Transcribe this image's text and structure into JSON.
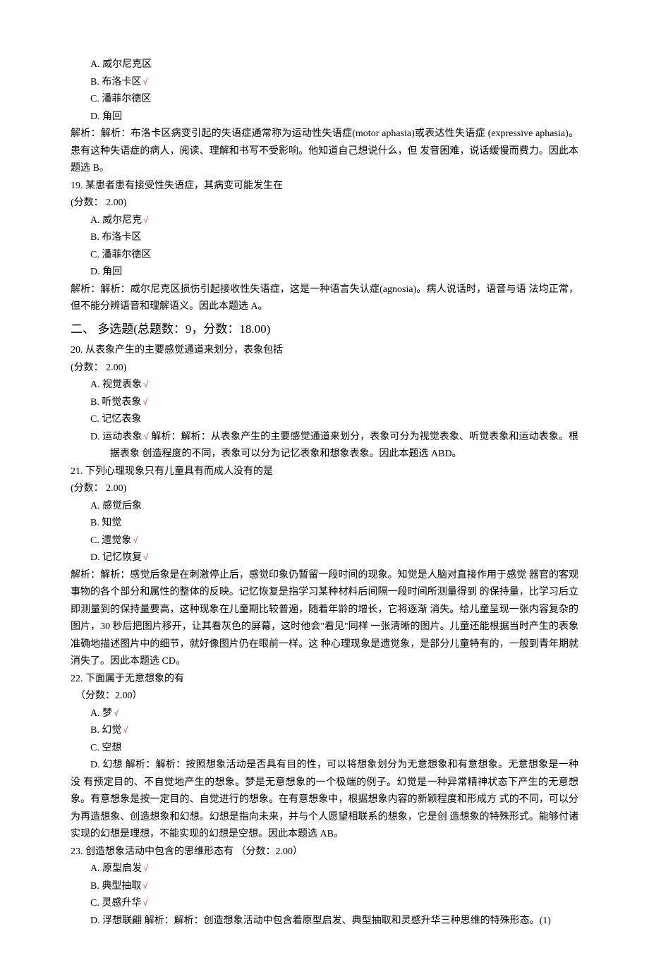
{
  "q18_top": {
    "optA": "A. 威尔尼克区",
    "optB": "B. 布洛卡区",
    "optC": "C. 潘菲尔德区",
    "optD": "D. 角回",
    "analysis": "解析：解析：布洛卡区病变引起的失语症通常称为运动性失语症(motor aphasia)或表达性失语症 (expressive aphasia)。患有这种失语症的病人，阅读、理解和书写不受影响。他知道自己想说什么，但 发音困难，说话缓慢而费力。因此本题选 B。"
  },
  "q19": {
    "stem": "19. 某患者患有接受性失语症，其病变可能发生在",
    "score": "(分数： 2.00)",
    "optA": "A. 威尔尼克",
    "optB": "B. 布洛卡区",
    "optC": "C. 潘菲尔德区",
    "optD": "D. 角回",
    "analysis": "解析：解析：威尔尼克区损伤引起接收性失语症，这是一种语言失认症(agnosia)。病人说话时，语音与语 法均正常，但不能分辨语音和理解语义。因此本题选 A。"
  },
  "section2": "二、 多选题(总题数：9，分数：18.00)",
  "q20": {
    "stem": "20. 从表象产生的主要感觉通道来划分，表象包括",
    "score": "(分数： 2.00)",
    "optA": "A. 视觉表象",
    "optB": "B. 听觉表象",
    "optC": "C. 记忆表象",
    "optD_full": "D. 运动表象 √ 解析：解析：从表象产生的主要感觉通道来划分，表象可分为视觉表象、听觉表象和运动表象。根据表象 创造程度的不同，表象可以分为记忆表象和想象表象。因此本题选 ABD。",
    "optD_prefix": "D. 运动表象",
    "optD_after": " 解析：解析：从表象产生的主要感觉通道来划分，表象可分为视觉表象、听觉表象和运动表象。根据表象 创造程度的不同，表象可以分为记忆表象和想象表象。因此本题选 ABD。"
  },
  "q21": {
    "stem": "21. 下列心理现象只有儿童具有而成人没有的是",
    "score": "(分数： 2.00)",
    "optA": "A. 感觉后象",
    "optB": "B. 知觉",
    "optC": "C. 遗觉象",
    "optD": "D. 记忆恢复",
    "analysis": "解析：解析：感觉后象是在刺激停止后，感觉印象仍暂留一段时间的现象。知觉是人脑对直接作用于感觉 器官的客观事物的各个部分和属性的整体的反映。记忆恢复是指学习某种材料后间隔一段时间所测量得到 的保持量，比学习后立即测量到的保持量要高，这种现象在儿童期比较普遍，随着年龄的增长，它将逐渐 消失。给儿童呈现一张内容复杂的图片，30 秒后把图片移开，让其看灰色的屏幕，这时他会\"看见\"同样 一张清晰的图片。儿童还能根据当时产生的表象准确地描述图片中的细节，就好像图片仍在眼前一样。这 种心理现象是遗觉象，是部分儿童特有的，一般到青年期就消失了。因此本题选 CD。"
  },
  "q22": {
    "stem": "22.  下面属于无意想象的有",
    "score": "（分数：2.00）",
    "optA": "A. 梦",
    "optB": "B. 幻觉",
    "optC": "C. 空想",
    "optD_prefix": "D. 幻想 解析：解析：按照想象活动是否具有目的性，可以将想象划分为无意想象和有意想象。无意想象是一种没 有预定目的、不自觉地产生的想象。梦是无意想象的一个极端的例子。幻觉是一种异常精神状态下产生的无意想象。有意想象是按一定目的、自觉进行的想象。在有意想象中，根据想象内容的新颖程度和形成方 式的不同，可以分为再造想象、创造想象和幻想。幻想是指向未来，并与个人愿望相联系的想象，它是创 造想象的特殊形式。能够付诸实现的幻想是理想，不能实现的幻想是空想。因此本题选 AB。"
  },
  "q23": {
    "stem": "23. 创造想象活动中包含的思维形态有 （分数：2.00）",
    "optA": "A. 原型启发",
    "optB": "B. 典型抽取",
    "optC": "C. 灵感升华",
    "optD_prefix": "D. 浮想联翩 解析：解析：创造想象活动中包含着原型启发、典型抽取和灵感升华三种思维的特殊形态。(1)"
  }
}
